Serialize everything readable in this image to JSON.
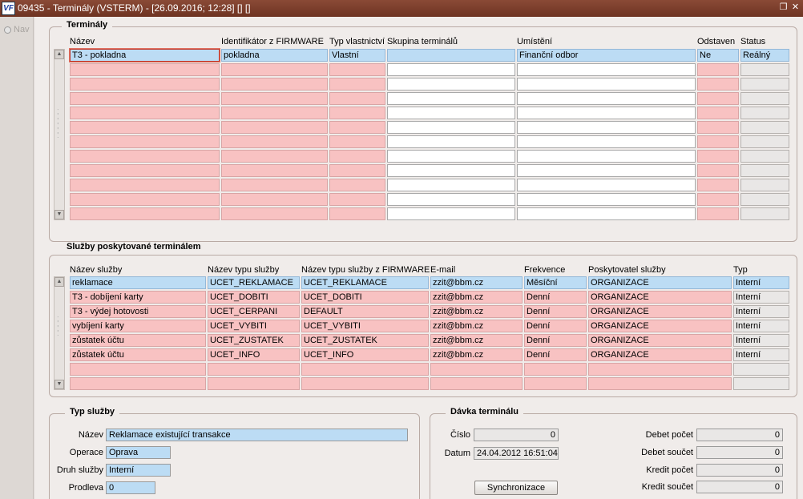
{
  "window": {
    "title": "09435 - Terminály (VSTERM) - [26.09.2016; 12:28] [] []",
    "logo": "VF",
    "restore_icon": "❐",
    "close_icon": "✕"
  },
  "nav": {
    "label": "Nav"
  },
  "terminaly": {
    "title": "Terminály",
    "columns": [
      "Název",
      "Identifikátor z FIRMWARE",
      "Typ vlastnictví",
      "Skupina terminálů",
      "Umístění",
      "Odstaven",
      "Status"
    ],
    "rows": [
      [
        "T3 - pokladna",
        "pokladna",
        "Vlastní",
        "",
        "Finanční odbor",
        "Ne",
        "Reálný"
      ]
    ],
    "empty_rows": 11
  },
  "sluzby": {
    "title": "Služby poskytované terminálem",
    "columns": [
      "Název služby",
      "Název typu služby",
      "Název typu služby z FIRMWARE",
      "E-mail",
      "Frekvence",
      "Poskytovatel služby",
      "Typ"
    ],
    "rows": [
      [
        "reklamace",
        "UCET_REKLAMACE",
        "UCET_REKLAMACE",
        "zzit@bbm.cz",
        "Měsíční",
        "ORGANIZACE",
        "Interní"
      ],
      [
        "T3 - dobíjení karty",
        "UCET_DOBITI",
        "UCET_DOBITI",
        "zzit@bbm.cz",
        "Denní",
        "ORGANIZACE",
        "Interní"
      ],
      [
        "T3 - výdej hotovosti",
        "UCET_CERPANI",
        "DEFAULT",
        "zzit@bbm.cz",
        "Denní",
        "ORGANIZACE",
        "Interní"
      ],
      [
        "vybíjení karty",
        "UCET_VYBITI",
        "UCET_VYBITI",
        "zzit@bbm.cz",
        "Denní",
        "ORGANIZACE",
        "Interní"
      ],
      [
        "zůstatek účtu",
        "UCET_ZUSTATEK",
        "UCET_ZUSTATEK",
        "zzit@bbm.cz",
        "Denní",
        "ORGANIZACE",
        "Interní"
      ],
      [
        "zůstatek účtu",
        "UCET_INFO",
        "UCET_INFO",
        "zzit@bbm.cz",
        "Denní",
        "ORGANIZACE",
        "Interní"
      ]
    ],
    "empty_rows": 2
  },
  "typ_sluzby": {
    "title": "Typ služby",
    "nazev_label": "Název",
    "nazev_value": "Reklamace existující transakce",
    "operace_label": "Operace",
    "operace_value": "Oprava",
    "druh_label": "Druh služby",
    "druh_value": "Interní",
    "prodleva_label": "Prodleva",
    "prodleva_value": "0"
  },
  "davka": {
    "title": "Dávka terminálu",
    "cislo_label": "Číslo",
    "cislo_value": "0",
    "datum_label": "Datum",
    "datum_value": "24.04.2012 16:51:04",
    "sync_label": "Synchronizace",
    "debet_pocet_label": "Debet počet",
    "debet_pocet_value": "0",
    "debet_soucet_label": "Debet součet",
    "debet_soucet_value": "0",
    "kredit_pocet_label": "Kredit počet",
    "kredit_pocet_value": "0",
    "kredit_soucet_label": "Kredit součet",
    "kredit_soucet_value": "0"
  },
  "colors": {
    "titlebar": "#7a3b28",
    "required_field": "#f8c2c2",
    "selected_row": "#bcdcf4"
  }
}
